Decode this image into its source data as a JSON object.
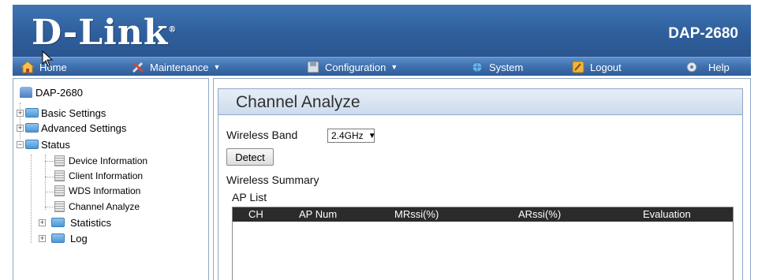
{
  "header": {
    "logo": "D-Link",
    "logo_mark": "®",
    "model": "DAP-2680"
  },
  "menu": {
    "home": "Home",
    "maintenance": "Maintenance",
    "configuration": "Configuration",
    "system": "System",
    "logout": "Logout",
    "help": "Help",
    "caret": "▼"
  },
  "tree": {
    "root": "DAP-2680",
    "basic_settings": "Basic Settings",
    "advanced_settings": "Advanced Settings",
    "status": "Status",
    "device_information": "Device Information",
    "client_information": "Client Information",
    "wds_information": "WDS Information",
    "channel_analyze": "Channel Analyze",
    "statistics": "Statistics",
    "log": "Log",
    "expand": "+",
    "collapse": "−"
  },
  "main": {
    "title": "Channel Analyze",
    "wireless_band_label": "Wireless Band",
    "wireless_band_value": "2.4GHz",
    "detect_button": "Detect",
    "wireless_summary": "Wireless Summary",
    "ap_list": "AP List",
    "table_headers": [
      "CH",
      "AP Num",
      "MRssi(%)",
      "ARssi(%)",
      "Evaluation"
    ]
  },
  "colors": {
    "header_blue": "#2f5f9c",
    "menubar_blue": "#3e6fae",
    "table_header": "#2b2b2b"
  },
  "icons": {
    "home": "home-icon",
    "maintenance": "tools-icon",
    "configuration": "floppy-icon",
    "system": "globe-icon",
    "logout": "logout-icon",
    "help": "help-icon"
  }
}
